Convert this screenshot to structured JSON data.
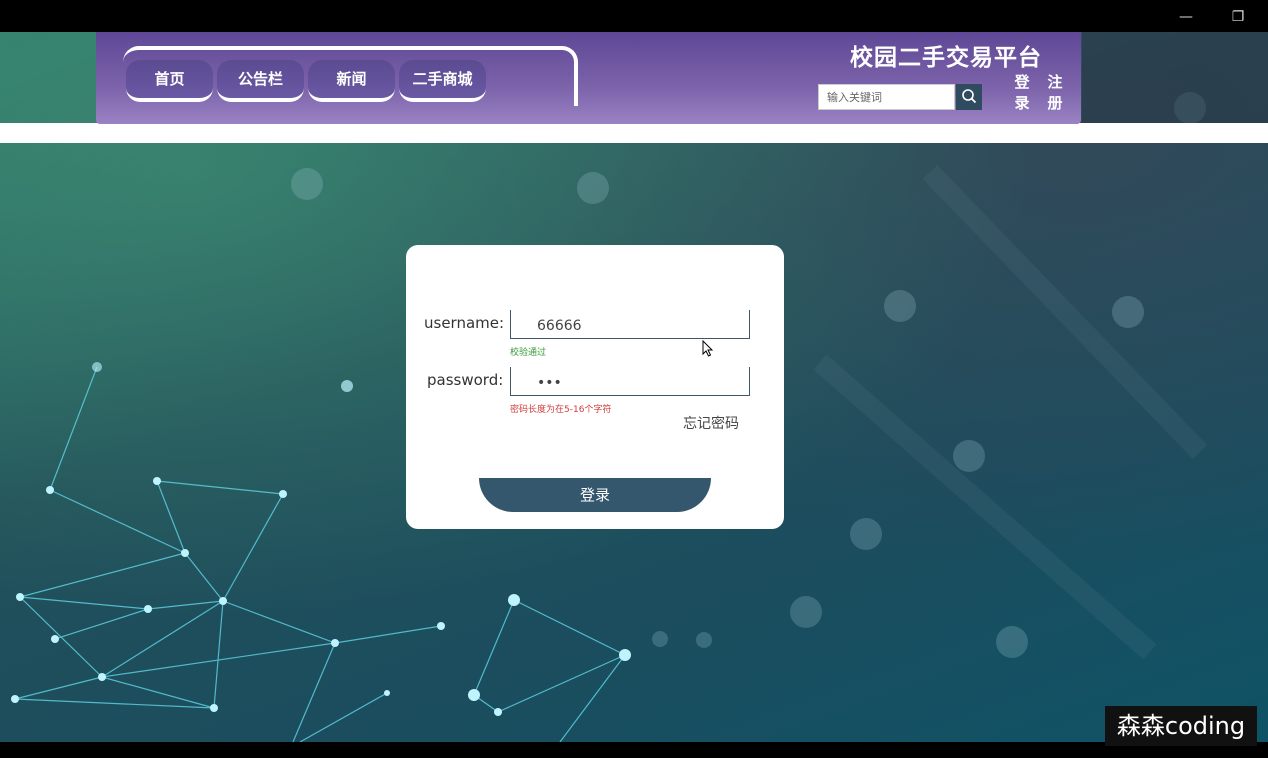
{
  "window": {
    "minimize_symbol": "—",
    "restore_symbol": "❐"
  },
  "header": {
    "site_title": "校园二手交易平台",
    "nav": [
      {
        "label": "首页"
      },
      {
        "label": "公告栏"
      },
      {
        "label": "新闻"
      },
      {
        "label": "二手商城"
      }
    ],
    "search": {
      "placeholder": "输入关键词",
      "value": "",
      "icon": "search-icon"
    },
    "login_link": "登录",
    "register_link": "注册"
  },
  "login_form": {
    "username_label": "username:",
    "username_value": "66666",
    "username_hint": "校验通过",
    "password_label": "password:",
    "password_value": "•••",
    "password_hint": "密码长度为在5-16个字符",
    "forgot_label": "忘记密码",
    "submit_label": "登录"
  },
  "watermark": "森森coding",
  "colors": {
    "header_purple": "#7c63aa",
    "nav_button": "#5b4b92",
    "login_button": "#34576e",
    "hint_ok": "#3a9a3a",
    "hint_error": "#d13c3c"
  }
}
